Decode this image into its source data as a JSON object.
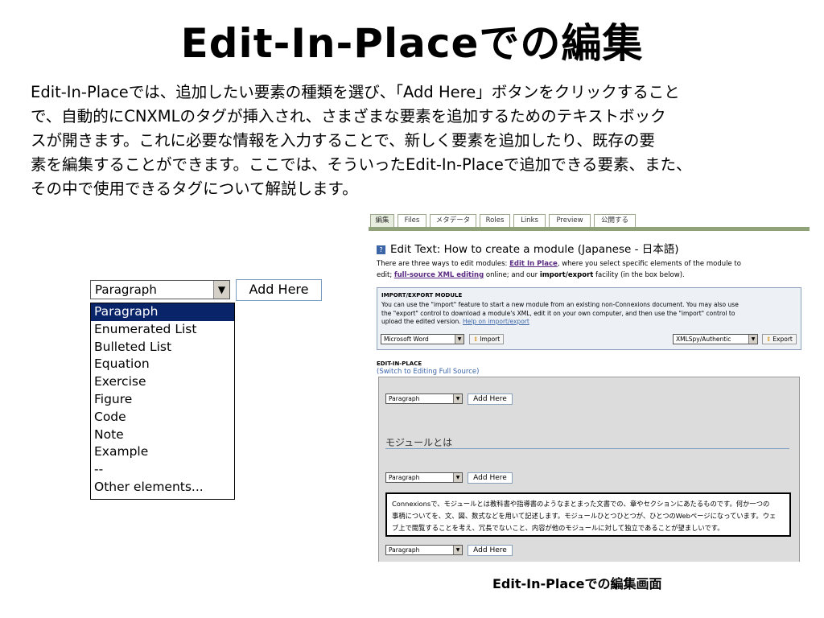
{
  "slide": {
    "title": "Edit-In-Placeでの編集",
    "body_lines": [
      "Edit-In-Placeでは、追加したい要素の種類を選び、「Add Here」ボタンをクリックすること",
      "で、自動的にCNXMLのタグが挿入され、さまざまな要素を追加するためのテキストボック",
      "スが開きます。これに必要な情報を入力することで、新しく要素を追加したり、既存の要",
      "素を編集することができます。ここでは、そういったEdit-In-Placeで追加できる要素、また、",
      "その中で使用できるタグについて解説します。"
    ],
    "caption": "Edit-In-Placeでの編集画面"
  },
  "dropdown": {
    "selected": "Paragraph",
    "add_button": "Add Here",
    "options": [
      "Paragraph",
      "Enumerated List",
      "Bulleted List",
      "Equation",
      "Exercise",
      "Figure",
      "Code",
      "Note",
      "Example",
      "--",
      "Other elements..."
    ]
  },
  "screenshot": {
    "tabs": [
      "編集",
      "Files",
      "メタデータ",
      "Roles",
      "Links",
      "Preview",
      "公開する"
    ],
    "edit_title": "Edit Text: How to create a module (Japanese - 日本語)",
    "intro_parts": {
      "a": "There are three ways to edit modules: ",
      "link1": "Edit In Place",
      "b": ", where you select specific elements of the module to",
      "c": "edit; ",
      "link2": "full-source XML editing",
      "d": " online; and our ",
      "bold": "import/export",
      "e": " facility (in the box below)."
    },
    "import_export": {
      "heading": "IMPORT/EXPORT MODULE",
      "text_lines": [
        "You can use the \"import\" feature to start a new module from an existing non-Connexions document. You may also use",
        "the \"export\" control to download a module's XML, edit it on your own computer, and then use the \"import\" control to",
        "upload the edited version. "
      ],
      "help_link": "Help on import/export",
      "import_format": "Microsoft Word",
      "import_button": "Import",
      "export_format": "XMLSpy/Authentic",
      "export_button": "Export"
    },
    "eip": {
      "heading": "EDIT-IN-PLACE",
      "switch_link": "(Switch to Editing Full Source)",
      "select_value": "Paragraph",
      "add_button": "Add Here",
      "module_heading": "モジュールとは",
      "paragraph_lines": [
        "Connexionsで、モジュールとは教科書や指導書のようなまとまった文書での、章やセクションにあたるものです。何か一つの",
        "事柄についてを、文、図、数式などを用いて記述します。モジュールひとつひとつが、ひとつのWebページになっています。ウェ",
        "ブ上で閲覧することを考え、冗長でないこと、内容が他のモジュールに対して独立であることが望ましいです。"
      ]
    }
  }
}
